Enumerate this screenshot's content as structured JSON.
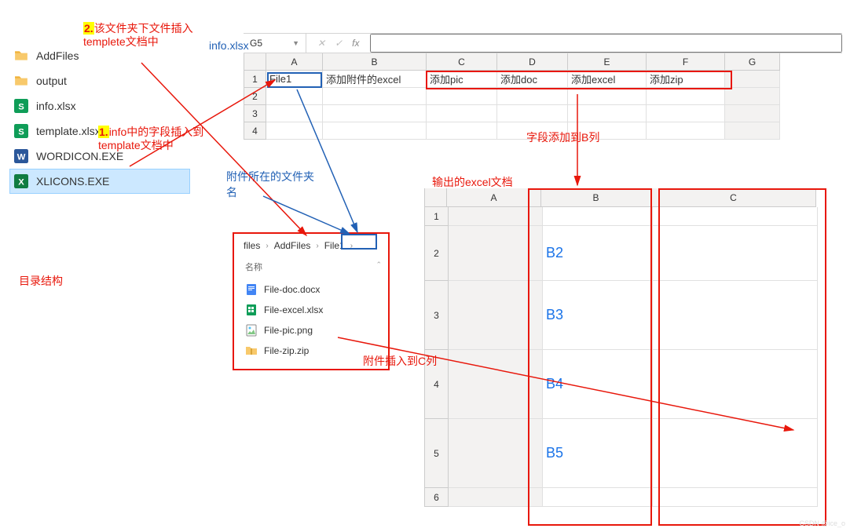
{
  "file_list": {
    "items": [
      {
        "name": "AddFiles",
        "icon": "folder"
      },
      {
        "name": "output",
        "icon": "folder"
      },
      {
        "name": "info.xlsx",
        "icon": "wps-s"
      },
      {
        "name": "template.xlsx",
        "icon": "wps-s"
      },
      {
        "name": "WORDICON.EXE",
        "icon": "word"
      },
      {
        "name": "XLICONS.EXE",
        "icon": "excel",
        "selected": true
      }
    ]
  },
  "sheet_top": {
    "name_box": "G5",
    "fx_label": "fx",
    "headers": [
      "A",
      "B",
      "C",
      "D",
      "E",
      "F",
      "G"
    ],
    "rows": [
      {
        "n": "1",
        "cells": [
          "File1",
          "添加附件的excel",
          "添加pic",
          "添加doc",
          "添加excel",
          "添加zip",
          ""
        ]
      },
      {
        "n": "2",
        "cells": [
          "",
          "",
          "",
          "",
          "",
          "",
          ""
        ]
      },
      {
        "n": "3",
        "cells": [
          "",
          "",
          "",
          "",
          "",
          "",
          ""
        ]
      },
      {
        "n": "4",
        "cells": [
          "",
          "",
          "",
          "",
          "",
          "",
          ""
        ]
      }
    ]
  },
  "folder_window": {
    "breadcrumb": [
      "files",
      "AddFiles",
      "File1"
    ],
    "header": "名称",
    "items": [
      {
        "name": "File-doc.docx",
        "icon": "docx"
      },
      {
        "name": "File-excel.xlsx",
        "icon": "xlsx"
      },
      {
        "name": "File-pic.png",
        "icon": "png"
      },
      {
        "name": "File-zip.zip",
        "icon": "zip"
      }
    ]
  },
  "output_sheet": {
    "headers": [
      "A",
      "B",
      "C"
    ],
    "rows": [
      {
        "n": "1",
        "b": "",
        "h": "grow1"
      },
      {
        "n": "2",
        "b": "B2",
        "h": "grow2"
      },
      {
        "n": "3",
        "b": "B3",
        "h": ""
      },
      {
        "n": "4",
        "b": "B4",
        "h": ""
      },
      {
        "n": "5",
        "b": "B5",
        "h": ""
      },
      {
        "n": "6",
        "b": "",
        "h": "grow1"
      }
    ]
  },
  "annotations": {
    "a1_prefix": "1.",
    "a1": "info中的字段插入到template文档中",
    "a2_prefix": "2.",
    "a2": "该文件夹下文件插入templete文档中",
    "a3": "info.xlsx",
    "a4": "目录结构",
    "a5": "附件所在的文件夹名",
    "a6": "字段添加到B列",
    "a7": "附件插入到C列",
    "a8": "输出的excel文档"
  },
  "watermark": "CSDN @ice_o"
}
